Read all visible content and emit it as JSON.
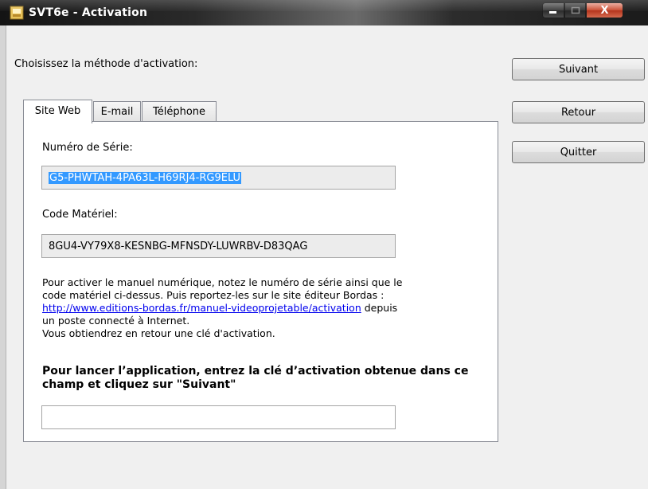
{
  "window": {
    "title": "SVT6e - Activation",
    "controls": {
      "minimize": "minimize",
      "maximize": "maximize",
      "close": "X"
    }
  },
  "prompt": "Choisissez la méthode d'activation:",
  "buttons": {
    "next": "Suivant",
    "back": "Retour",
    "quit": "Quitter"
  },
  "tabs": [
    {
      "label": "Site Web",
      "active": true
    },
    {
      "label": "E-mail",
      "active": false
    },
    {
      "label": "Téléphone",
      "active": false
    }
  ],
  "panel": {
    "serial_label": "Numéro de Série:",
    "serial_value": "G5-PHWTAH-4PA63L-H69RJ4-RG9ELU",
    "hardware_label": "Code Matériel:",
    "hardware_value": "8GU4-VY79X8-KESNBG-MFNSDY-LUWRBV-D83QAG",
    "instructions": {
      "line1": "Pour activer le manuel numérique, notez le numéro de série ainsi que le",
      "line2": "code matériel ci-dessus. Puis reportez-les sur le site éditeur Bordas :",
      "link": "http://www.editions-bordas.fr/manuel-videoprojetable/activation",
      "after_link": " depuis",
      "line4": "un poste connecté à Internet.",
      "line5": "Vous obtiendrez en retour une clé d'activation."
    },
    "key_prompt": "Pour lancer l’application, entrez la clé d’activation obtenue dans ce champ et cliquez sur \"Suivant\"",
    "key_value": ""
  },
  "colors": {
    "selection": "#3399ff",
    "link": "#0000ee",
    "close": "#c8492e"
  }
}
